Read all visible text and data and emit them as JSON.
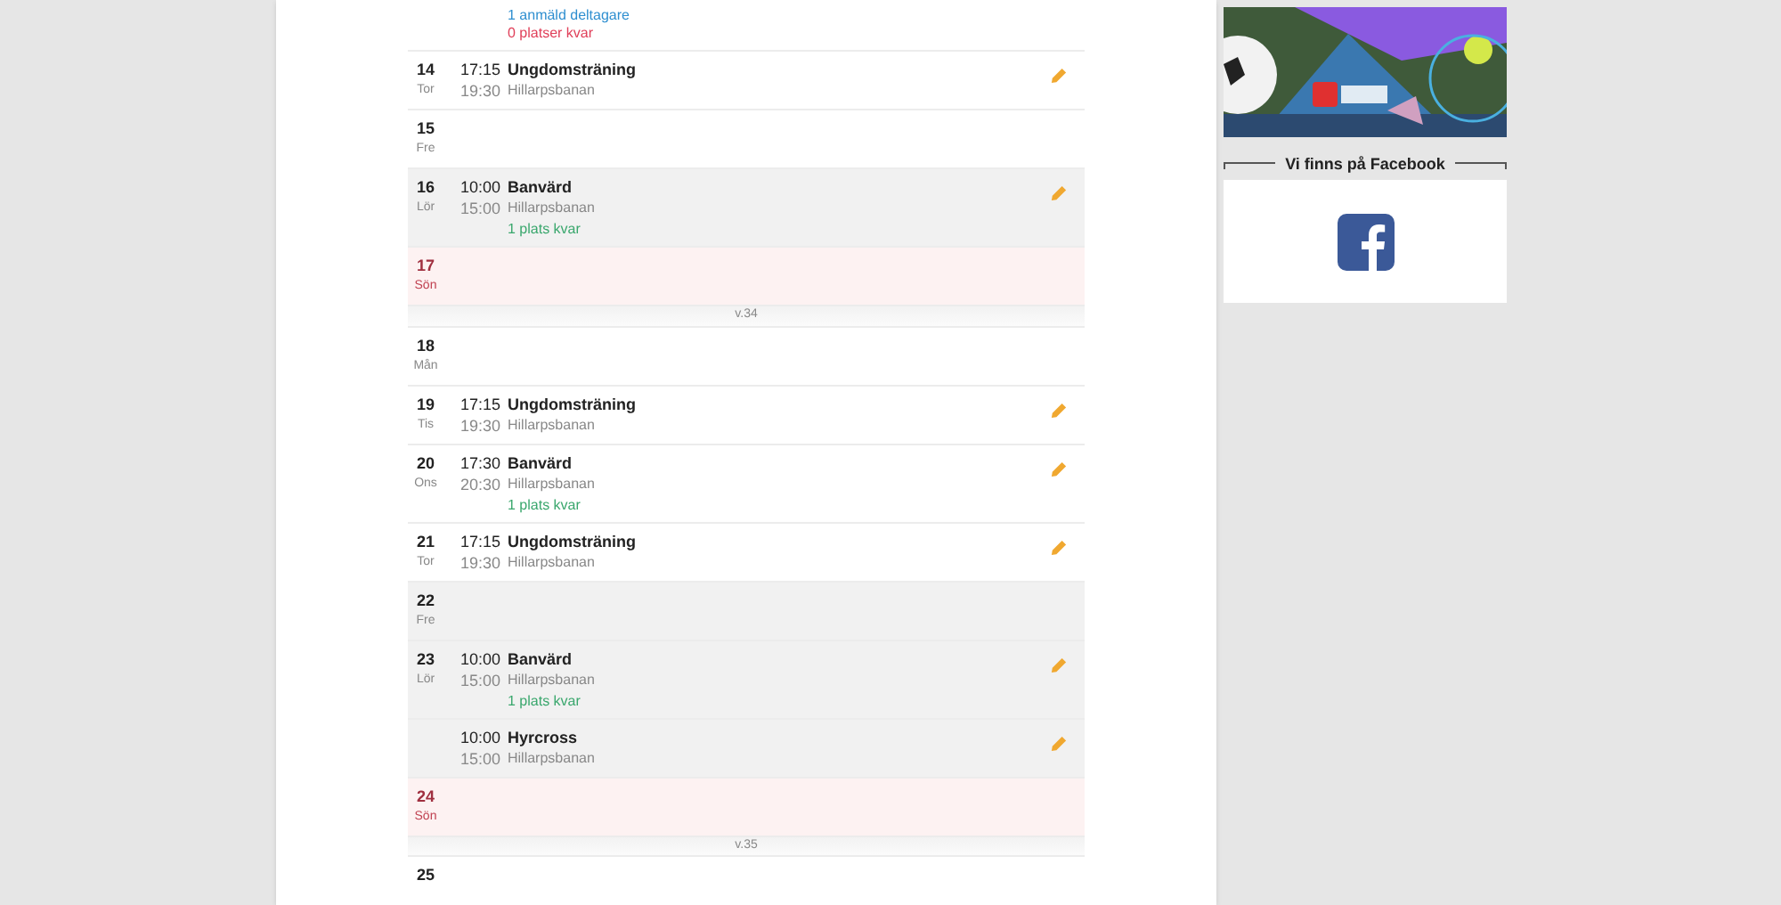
{
  "calendar": [
    {
      "kind": "day",
      "shaded": false,
      "sunday": false,
      "events": [
        {
          "notes": [
            {
              "text": "1 anmäld deltagare",
              "kind": "info"
            },
            {
              "text": "0 platser kvar",
              "kind": "full"
            }
          ]
        }
      ]
    },
    {
      "kind": "day",
      "shaded": false,
      "sunday": false,
      "day": "14",
      "weekday": "Tor",
      "events": [
        {
          "start": "17:15",
          "end": "19:30",
          "title": "Ungdomsträning",
          "place": "Hillarpsbanan",
          "editable": true
        }
      ]
    },
    {
      "kind": "day",
      "shaded": false,
      "sunday": false,
      "day": "15",
      "weekday": "Fre"
    },
    {
      "kind": "day",
      "shaded": true,
      "sunday": false,
      "day": "16",
      "weekday": "Lör",
      "events": [
        {
          "start": "10:00",
          "end": "15:00",
          "title": "Banvärd",
          "place": "Hillarpsbanan",
          "editable": true,
          "notes": [
            {
              "text": "1 plats kvar",
              "kind": "free"
            }
          ]
        }
      ]
    },
    {
      "kind": "day",
      "shaded": false,
      "sunday": true,
      "day": "17",
      "weekday": "Sön"
    },
    {
      "kind": "week",
      "label": "v.34"
    },
    {
      "kind": "day",
      "shaded": false,
      "sunday": false,
      "day": "18",
      "weekday": "Mån"
    },
    {
      "kind": "day",
      "shaded": false,
      "sunday": false,
      "day": "19",
      "weekday": "Tis",
      "events": [
        {
          "start": "17:15",
          "end": "19:30",
          "title": "Ungdomsträning",
          "place": "Hillarpsbanan",
          "editable": true
        }
      ]
    },
    {
      "kind": "day",
      "shaded": false,
      "sunday": false,
      "day": "20",
      "weekday": "Ons",
      "events": [
        {
          "start": "17:30",
          "end": "20:30",
          "title": "Banvärd",
          "place": "Hillarpsbanan",
          "editable": true,
          "notes": [
            {
              "text": "1 plats kvar",
              "kind": "free"
            }
          ]
        }
      ]
    },
    {
      "kind": "day",
      "shaded": false,
      "sunday": false,
      "day": "21",
      "weekday": "Tor",
      "events": [
        {
          "start": "17:15",
          "end": "19:30",
          "title": "Ungdomsträning",
          "place": "Hillarpsbanan",
          "editable": true
        }
      ]
    },
    {
      "kind": "day",
      "shaded": true,
      "sunday": false,
      "day": "22",
      "weekday": "Fre"
    },
    {
      "kind": "day",
      "shaded": true,
      "sunday": false,
      "day": "23",
      "weekday": "Lör",
      "events": [
        {
          "start": "10:00",
          "end": "15:00",
          "title": "Banvärd",
          "place": "Hillarpsbanan",
          "editable": true,
          "notes": [
            {
              "text": "1 plats kvar",
              "kind": "free"
            }
          ]
        },
        {
          "start": "10:00",
          "end": "15:00",
          "title": "Hyrcross",
          "place": "Hillarpsbanan",
          "editable": true
        }
      ]
    },
    {
      "kind": "day",
      "shaded": false,
      "sunday": true,
      "day": "24",
      "weekday": "Sön"
    },
    {
      "kind": "week",
      "label": "v.35"
    },
    {
      "kind": "day",
      "shaded": false,
      "sunday": false,
      "day": "25"
    }
  ],
  "sidebar": {
    "facebook": {
      "heading": "Vi finns på Facebook"
    }
  }
}
